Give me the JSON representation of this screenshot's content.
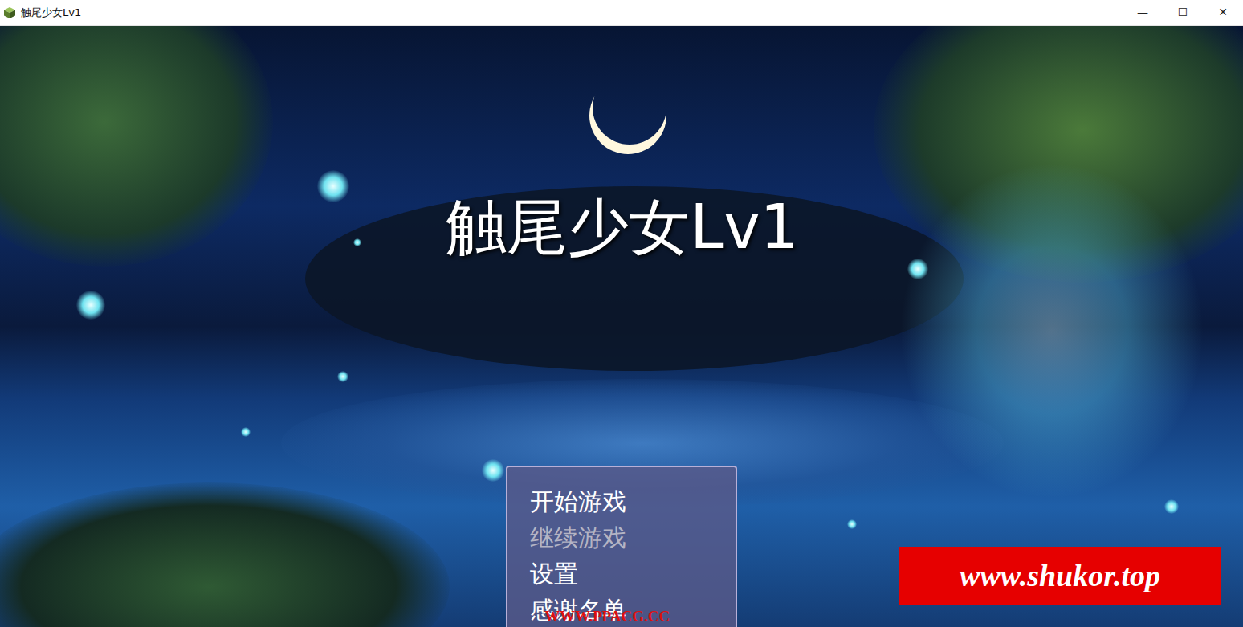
{
  "window": {
    "title": "触尾少女Lv1",
    "controls": [
      "—",
      "☐",
      "✕"
    ]
  },
  "game": {
    "title": "触尾少女Lv1"
  },
  "menu": {
    "items": [
      {
        "label": "开始游戏",
        "disabled": false
      },
      {
        "label": "继续游戏",
        "disabled": true
      },
      {
        "label": "设置",
        "disabled": false
      },
      {
        "label": "感谢名单",
        "disabled": false
      }
    ]
  },
  "watermark_site": {
    "text": "www.shukor.top"
  },
  "watermark_footer": {
    "text": "WWW.PPACG.CC"
  }
}
